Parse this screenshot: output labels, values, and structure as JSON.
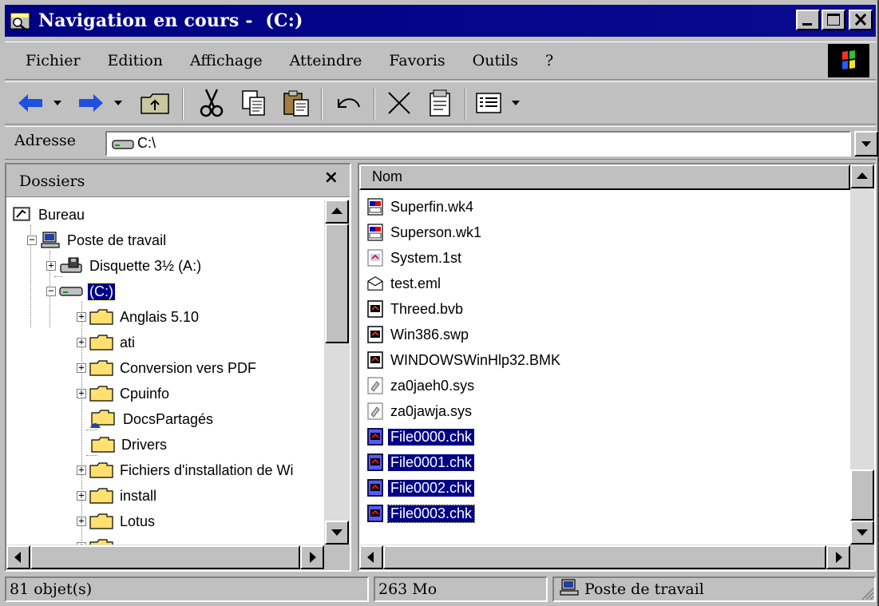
{
  "window": {
    "title": "Navigation en cours -  (C:)"
  },
  "menu": {
    "items": [
      {
        "label": "Fichier"
      },
      {
        "label": "Edition"
      },
      {
        "label": "Affichage"
      },
      {
        "label": "Atteindre"
      },
      {
        "label": "Favoris"
      },
      {
        "label": "Outils"
      },
      {
        "label": "?"
      }
    ]
  },
  "toolbar": {
    "buttons": [
      "back-icon",
      "forward-icon",
      "up-folder-icon",
      "cut-icon",
      "copy-icon",
      "paste-icon",
      "undo-icon",
      "delete-icon",
      "properties-icon",
      "views-icon"
    ]
  },
  "address": {
    "label": "Adresse",
    "value": "C:\\"
  },
  "folders": {
    "title": "Dossiers",
    "close_glyph": "×",
    "tree": [
      {
        "label": "Bureau",
        "icon": "desktop-icon"
      },
      {
        "label": "Poste de travail",
        "icon": "computer-icon"
      },
      {
        "label": "Disquette 3½ (A:)",
        "icon": "floppy-drive-icon"
      },
      {
        "label": "(C:)",
        "icon": "hard-drive-icon",
        "selected": true
      },
      {
        "label": "Anglais 5.10",
        "icon": "folder-icon"
      },
      {
        "label": "ati",
        "icon": "folder-icon"
      },
      {
        "label": "Conversion vers PDF",
        "icon": "folder-icon"
      },
      {
        "label": "Cpuinfo",
        "icon": "folder-icon"
      },
      {
        "label": "DocsPartagés",
        "icon": "shared-folder-icon"
      },
      {
        "label": "Drivers",
        "icon": "folder-icon"
      },
      {
        "label": "Fichiers d'installation de Wi",
        "icon": "folder-icon"
      },
      {
        "label": "install",
        "icon": "folder-icon"
      },
      {
        "label": "Lotus",
        "icon": "folder-icon"
      },
      {
        "label": "",
        "icon": "folder-icon"
      }
    ]
  },
  "files": {
    "column_name": "Nom",
    "items": [
      {
        "name": "Superfin.wk4",
        "icon": "spreadsheet-file-icon"
      },
      {
        "name": "Superson.wk1",
        "icon": "spreadsheet-file-icon"
      },
      {
        "name": "System.1st",
        "icon": "system-file-icon"
      },
      {
        "name": "test.eml",
        "icon": "email-file-icon"
      },
      {
        "name": "Threed.bvb",
        "icon": "system-file-icon"
      },
      {
        "name": "Win386.swp",
        "icon": "system-file-icon"
      },
      {
        "name": "WINDOWSWinHlp32.BMK",
        "icon": "system-file-icon"
      },
      {
        "name": "za0jaeh0.sys",
        "icon": "config-file-icon"
      },
      {
        "name": "za0jawja.sys",
        "icon": "config-file-icon"
      },
      {
        "name": "File0000.chk",
        "icon": "system-file-icon",
        "selected": true
      },
      {
        "name": "File0001.chk",
        "icon": "system-file-icon",
        "selected": true
      },
      {
        "name": "File0002.chk",
        "icon": "system-file-icon",
        "selected": true
      },
      {
        "name": "File0003.chk",
        "icon": "system-file-icon",
        "selected": true
      }
    ]
  },
  "status": {
    "count": "81 objet(s)",
    "size": "263 Mo",
    "location": "Poste de travail"
  },
  "colors": {
    "titlebar": "#000084",
    "selection": "#000084",
    "chrome": "#c0c0c0"
  }
}
